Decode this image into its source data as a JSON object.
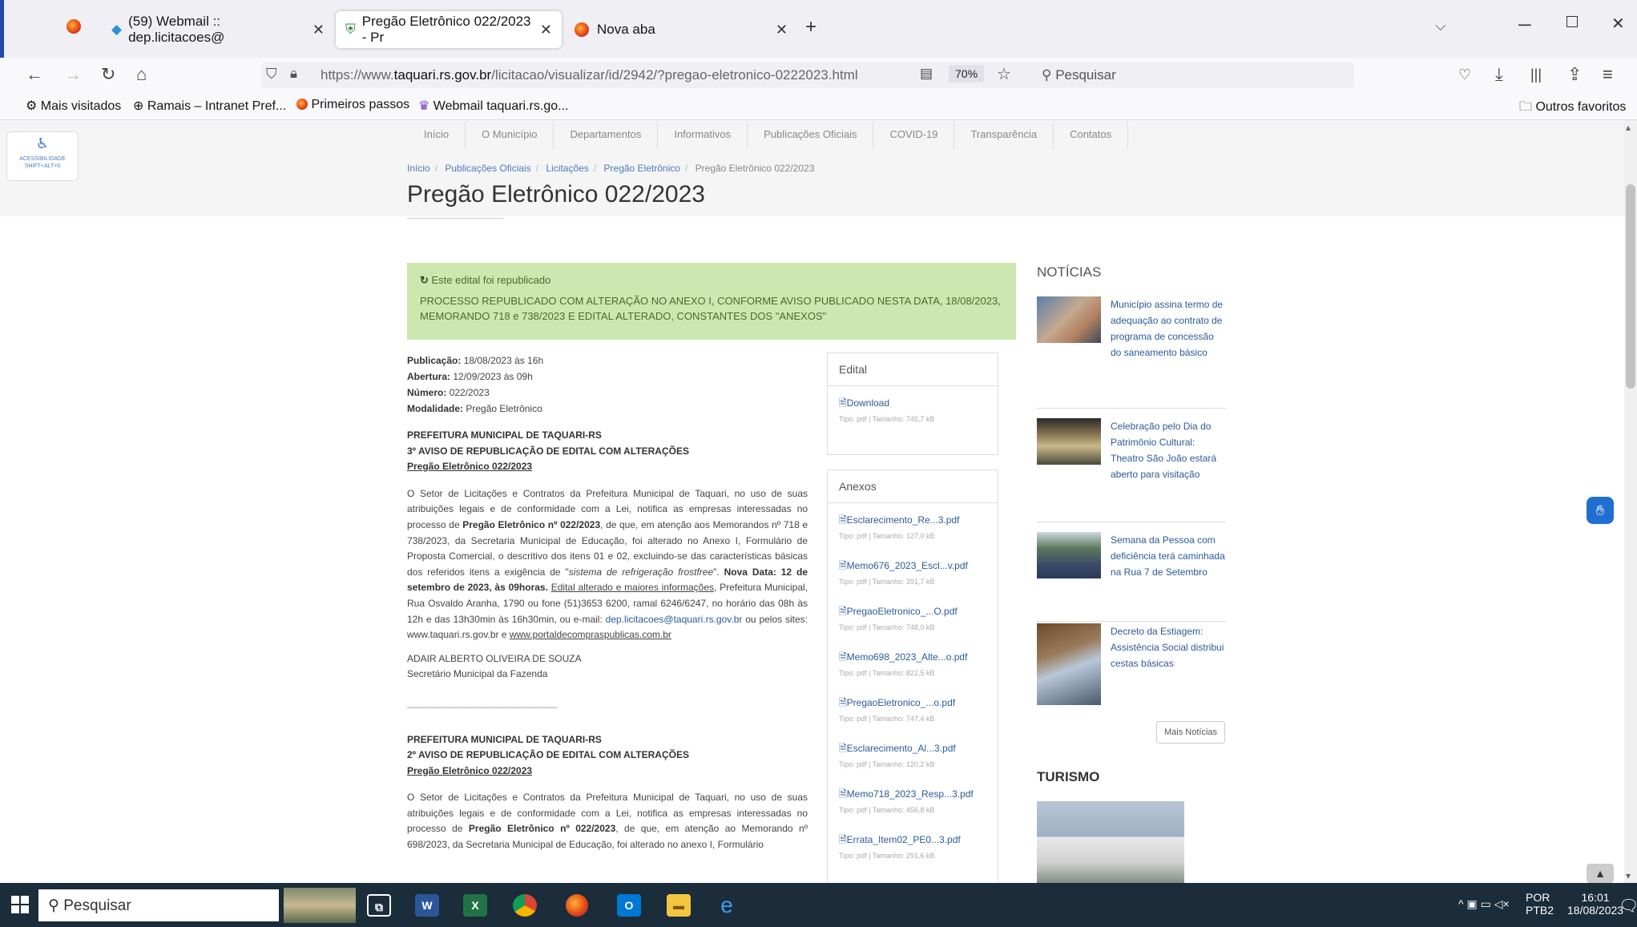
{
  "browser": {
    "tabs": [
      {
        "label": "(59) Webmail :: dep.licitacoes@"
      },
      {
        "label": "Pregão Eletrônico 022/2023 - Pr"
      },
      {
        "label": "Nova aba"
      }
    ],
    "url_prefix": "https://www.",
    "url_domain": "taquari.rs.gov.br",
    "url_path": "/licitacao/visualizar/id/2942/?pregao-eletronico-0222023.html",
    "zoom": "70%",
    "search_placeholder": "Pesquisar",
    "bookmarks": [
      "Mais visitados",
      "Ramais – Intranet Pref...",
      "Primeiros passos",
      "Webmail taquari.rs.go..."
    ],
    "other_bookmarks": "Outros favoritos"
  },
  "site": {
    "accessibility_label": "ACESSIBILIDADE SHIFT+ALT+0",
    "menu": [
      "Início",
      "O Município",
      "Departamentos",
      "Informativos",
      "Publicações Oficiais",
      "COVID-19",
      "Transparência",
      "Contatos"
    ],
    "breadcrumb": [
      "Início",
      "Publicações Oficiais",
      "Licitações",
      "Pregão Eletrônico",
      "Pregão Eletrônico 022/2023"
    ],
    "title": "Pregão Eletrônico 022/2023"
  },
  "notice": {
    "heading": "Este edital foi republicado",
    "text": "PROCESSO REPUBLICADO COM ALTERAÇÃO NO ANEXO I, CONFORME AVISO PUBLICADO NESTA DATA, 18/08/2023, MEMORANDO 718 e 738/2023 E EDITAL ALTERADO, CONSTANTES DOS \"ANEXOS\""
  },
  "details": {
    "publicacao_label": "Publicação:",
    "publicacao": "18/08/2023 às 16h",
    "abertura_label": "Abertura:",
    "abertura": "12/09/2023 às 09h",
    "numero_label": "Número:",
    "numero": "022/2023",
    "modalidade_label": "Modalidade:",
    "modalidade": "Pregão Eletrônico"
  },
  "aviso3": {
    "org": "PREFEITURA MUNICIPAL DE TAQUARI-RS",
    "heading": "3º AVISO DE REPUBLICAÇÃO DE EDITAL COM ALTERAÇÕES",
    "sub": "Pregão Eletrônico 022/2023",
    "p1": "O Setor de Licitações e Contratos da Prefeitura Municipal de Taquari, no uso de suas atribuições legais e de conformidade com a Lei, notifica as empresas interessadas no processo de",
    "p1b": "Pregão Eletrônico nº 022/2023",
    "p1c": ", de que, em atenção aos Memorandos nº 718 e 738/2023, da Secretaria Municipal de Educação, foi alterado no Anexo I, Formulário de Proposta Comercial, o descritivo dos itens 01 e 02, excluindo-se das características básicas dos referidos itens a exigência de \"",
    "p1i": "sistema de refrigeração frostfree",
    "p1d": "\". ",
    "p1e": "Nova Data: 12 de setembro de 2023, às 09horas.",
    "p1f": " ",
    "p1u": "Edital alterado e maiores informações",
    "p1g": ", Prefeitura Municipal, Rua Osvaldo Aranha, 1790 ou fone (51)3653 6200, ramal 6246/6247, no horário das 08h às 12h e das 13h30min às 16h30min, ou e-mail: ",
    "email": "dep.licitacoes@taquari.rs.gov.br",
    "p1h": " ou pelos sites: ",
    "site1": "www.taquari.rs.gov.br",
    "p1j": " e ",
    "site2": "www.portaldecompraspublicas.com.br",
    "signer": "ADAIR ALBERTO OLIVEIRA DE SOUZA",
    "signer_role": "Secretário Municipal da Fazenda",
    "rule": "____________________________"
  },
  "aviso2": {
    "org": "PREFEITURA MUNICIPAL DE TAQUARI-RS",
    "heading": "2º AVISO DE REPUBLICAÇÃO DE EDITAL COM ALTERAÇÕES",
    "sub": "Pregão Eletrônico 022/2023",
    "p1": "O Setor de Licitações e Contratos da Prefeitura Municipal de Taquari, no uso de suas atribuições legais e de conformidade com a Lei, notifica as empresas interessadas no processo de",
    "p1b": "Pregão Eletrônico nº 022/2023",
    "p1c": ", de que, em atenção ao Memorando nº 698/2023, da Secretaria Municipal de Educação, foi alterado no anexo I, Formulário"
  },
  "edital": {
    "heading": "Edital",
    "file": {
      "name": "Download",
      "meta": "Tipo: pdf | Tamanho: 745,7 kB"
    }
  },
  "anexos": {
    "heading": "Anexos",
    "files": [
      {
        "name": "Esclarecimento_Re...3.pdf",
        "meta": "Tipo: pdf | Tamanho: 127,0 kB"
      },
      {
        "name": "Memo676_2023_Escl...v.pdf",
        "meta": "Tipo: pdf | Tamanho: 391,7 kB"
      },
      {
        "name": "PregaoEletronico_...O.pdf",
        "meta": "Tipo: pdf | Tamanho: 748,0 kB"
      },
      {
        "name": "Memo698_2023_Alte...o.pdf",
        "meta": "Tipo: pdf | Tamanho: 822,5 kB"
      },
      {
        "name": "PregaoEletronico_...o.pdf",
        "meta": "Tipo: pdf | Tamanho: 747,4 kB"
      },
      {
        "name": "Esclarecimento_Al...3.pdf",
        "meta": "Tipo: pdf | Tamanho: 120,2 kB"
      },
      {
        "name": "Memo718_2023_Resp...3.pdf",
        "meta": "Tipo: pdf | Tamanho: 456,8 kB"
      },
      {
        "name": "Errata_Item02_PE0...3.pdf",
        "meta": "Tipo: pdf | Tamanho: 291,6 kB"
      }
    ]
  },
  "noticias": {
    "heading": "NOTÍCIAS",
    "items": [
      {
        "title": "Município assina termo de adequação ao contrato de programa de concessão do saneamento básico"
      },
      {
        "title": "Celebração pelo Dia do Patrimônio Cultural: Theatro São João estará aberto para visitação"
      },
      {
        "title": "Semana da Pessoa com deficiência terá caminhada na Rua 7 de Setembro"
      },
      {
        "title": "Decreto da Estiagem: Assistência Social distribui cestas básicas"
      }
    ],
    "more": "Mais Notícias"
  },
  "turismo": {
    "heading": "TURISMO"
  },
  "taskbar": {
    "search": "Pesquisar",
    "lang": "POR",
    "layout": "PTB2",
    "time": "16:01",
    "date": "18/08/2023"
  }
}
